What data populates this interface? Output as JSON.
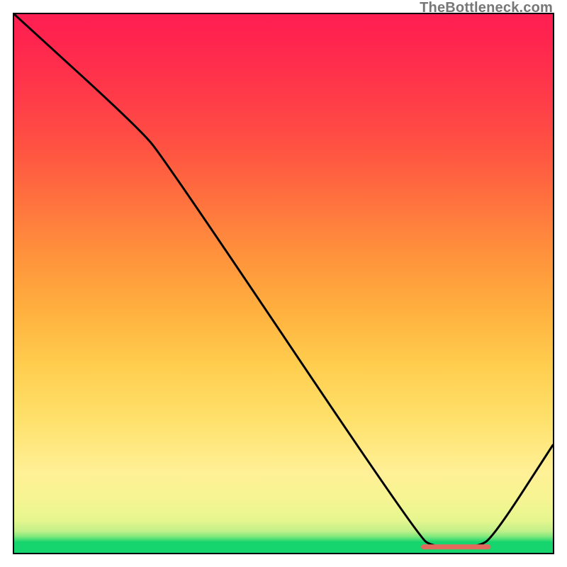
{
  "attribution": "TheBottleneck.com",
  "chart_data": {
    "type": "line",
    "title": "",
    "xlabel": "",
    "ylabel": "",
    "xlim": [
      0,
      100
    ],
    "ylim": [
      0,
      100
    ],
    "curve": [
      {
        "x": 0,
        "y": 100
      },
      {
        "x": 23,
        "y": 79
      },
      {
        "x": 28,
        "y": 73
      },
      {
        "x": 75,
        "y": 3
      },
      {
        "x": 78,
        "y": 1
      },
      {
        "x": 86,
        "y": 1
      },
      {
        "x": 89,
        "y": 3
      },
      {
        "x": 100,
        "y": 20
      }
    ],
    "flat_segment": {
      "x0": 76,
      "x1": 88,
      "y": 1.1,
      "color": "#e4695d"
    },
    "gradient_stops": [
      {
        "pct": 0,
        "color": "#16d46e"
      },
      {
        "pct": 2,
        "color": "#16d46e"
      },
      {
        "pct": 3,
        "color": "#7de87c"
      },
      {
        "pct": 4,
        "color": "#c0f08a"
      },
      {
        "pct": 6,
        "color": "#e6f68e"
      },
      {
        "pct": 10,
        "color": "#f6f592"
      },
      {
        "pct": 15,
        "color": "#fff096"
      },
      {
        "pct": 25,
        "color": "#ffe06a"
      },
      {
        "pct": 35,
        "color": "#ffcd4e"
      },
      {
        "pct": 45,
        "color": "#ffb03e"
      },
      {
        "pct": 55,
        "color": "#ff933c"
      },
      {
        "pct": 65,
        "color": "#ff733e"
      },
      {
        "pct": 75,
        "color": "#ff5342"
      },
      {
        "pct": 85,
        "color": "#ff3a49"
      },
      {
        "pct": 95,
        "color": "#ff254e"
      },
      {
        "pct": 100,
        "color": "#ff1f53"
      }
    ]
  }
}
